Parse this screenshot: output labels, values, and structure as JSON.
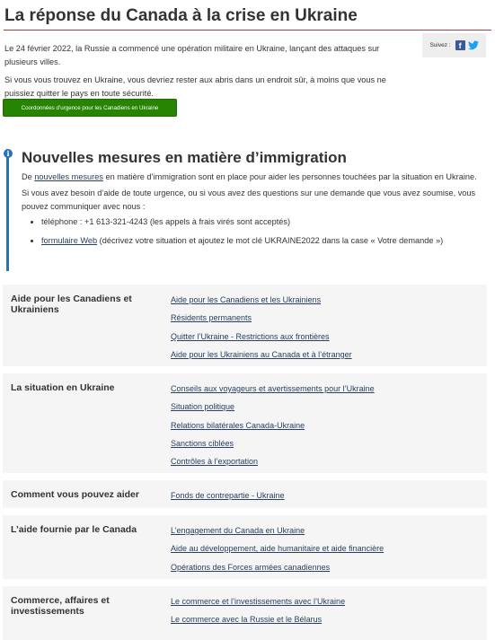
{
  "page_title": "La réponse du Canada à la crise en Ukraine",
  "intro": {
    "paragraph1": "Le 24 février 2022, la Russie a commencé une opération militaire en Ukraine, lançant des attaques sur plusieurs villes.",
    "paragraph2": "Si vous vous trouvez en Ukraine, vous devriez rester aux abris dans un endroit sûr, à moins que vous ne puissiez quitter le pays en toute sécurité."
  },
  "share": {
    "label": "Suivez :",
    "facebook_icon": "facebook-icon",
    "twitter_icon": "twitter-icon"
  },
  "emergency_button": "Coordonnées d’urgence pour les Canadiens en Ukraine",
  "alert": {
    "icon": "info-icon",
    "title": "Nouvelles mesures en matière d’immigration",
    "p1_prefix": "De ",
    "p1_link": "nouvelles mesures",
    "p1_suffix": " en matière d’immigration sont en place pour aider les personnes touchées par la situation en Ukraine.",
    "p2": "Si vous avez besoin d’aide de toute urgence, ou si vous avez des questions sur une demande que vous avez soumise, vous pouvez communiquer avec nous :",
    "bullet1": "téléphone : +1 613-321-4243 (les appels à frais virés sont acceptés)",
    "bullet2_link": "formulaire Web",
    "bullet2_suffix": " (décrivez votre situation et ajoutez le mot clé UKRAINE2022 dans la case « Votre demande »)"
  },
  "sections": [
    {
      "label": "Aide pour les Canadiens et Ukrainiens",
      "links": [
        "Aide pour les Canadiens et les Ukrainiens",
        "Résidents permanents",
        "Quitter l’Ukraine - Restrictions aux frontières",
        "Aide pour les Ukrainiens au Canada et à l’étranger"
      ]
    },
    {
      "label": "La situation en Ukraine",
      "links": [
        "Conseils aux voyageurs et avertissements pour l’Ukraine",
        "Situation politique",
        "Relations bilatérales Canada-Ukraine",
        "Sanctions ciblées",
        "Contrôles à l’exportation"
      ]
    },
    {
      "label": "Comment vous pouvez aider",
      "links": [
        "Fonds de contrepartie - Ukraine"
      ]
    },
    {
      "label": "L’aide fournie par le Canada",
      "links": [
        "L’engagement du Canada en Ukraine",
        "Aide au développement, aide humanitaire et aide financière",
        "Opérations des Forces armées canadiennes"
      ]
    },
    {
      "label": "Commerce, affaires et investissements",
      "links": [
        "Le commerce et l’investissements avec l’Ukraine",
        "Le commerce avec la Russie et le Bélarus"
      ]
    }
  ],
  "colors": {
    "accent_rule": "#af3c43",
    "button_green": "#278400",
    "info_blue": "#2572b4",
    "link": "#284162",
    "row_bg": "#f5f5f5"
  }
}
